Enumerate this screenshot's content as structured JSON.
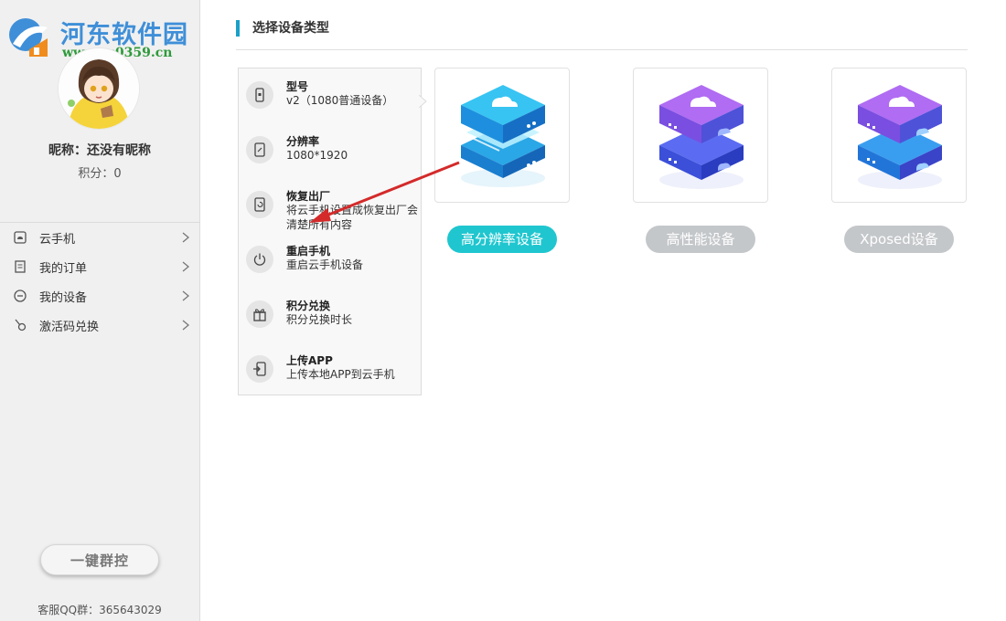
{
  "watermark": {
    "title": "河东软件园",
    "url": "www.pc0359.cn"
  },
  "profile": {
    "nickname": "昵称：还没有昵称",
    "points": "积分：0"
  },
  "menu": [
    {
      "label": "云手机",
      "icon": "cloud-phone-icon"
    },
    {
      "label": "我的订单",
      "icon": "order-icon"
    },
    {
      "label": "我的设备",
      "icon": "device-icon"
    },
    {
      "label": "激活码兑换",
      "icon": "activation-code-icon"
    }
  ],
  "group_control": {
    "label": "一键群控"
  },
  "support": {
    "qq": "客服QQ群：365643029"
  },
  "main": {
    "section_title": "选择设备类型",
    "device_types": [
      {
        "label": "高分辨率设备",
        "selected": true,
        "color": "#1fc6cf"
      },
      {
        "label": "高性能设备",
        "selected": false,
        "color": "#c4c7ca"
      },
      {
        "label": "Xposed设备",
        "selected": false,
        "color": "#c4c7ca"
      }
    ]
  },
  "info_panel": {
    "rows": [
      {
        "title": "型号",
        "desc": "v2（1080普通设备）",
        "icon": "phone-model-icon"
      },
      {
        "title": "分辨率",
        "desc": "1080*1920",
        "icon": "resolution-icon"
      },
      {
        "title": "恢复出厂",
        "desc": "将云手机设置成恢复出厂会清楚所有内容",
        "icon": "factory-reset-icon"
      },
      {
        "title": "重启手机",
        "desc": "重启云手机设备",
        "icon": "power-icon"
      },
      {
        "title": "积分兑换",
        "desc": "积分兑换时长",
        "icon": "gift-icon"
      },
      {
        "title": "上传APP",
        "desc": "上传本地APP到云手机",
        "icon": "upload-app-icon"
      }
    ]
  },
  "colors": {
    "accent": "#1aa0c8",
    "annotation_arrow": "#d42a2a"
  }
}
